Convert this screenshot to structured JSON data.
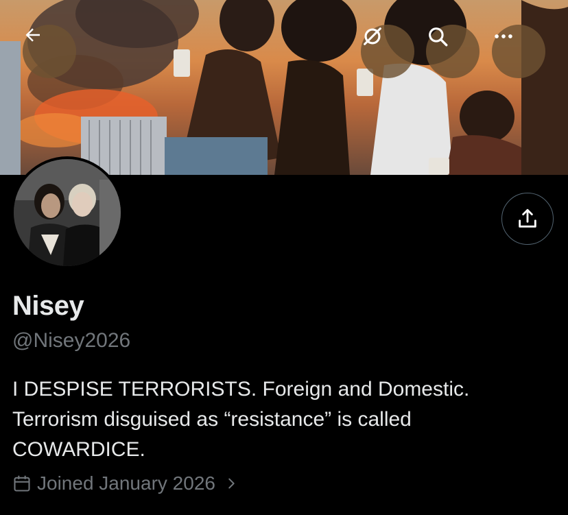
{
  "header": {
    "back_icon": "arrow-left-icon",
    "grok_icon": "grok-icon",
    "search_icon": "search-icon",
    "more_icon": "more-horizontal-icon"
  },
  "profile": {
    "display_name": "Nisey",
    "handle": "@Nisey2026",
    "bio_lines": [
      "I DESPISE TERRORISTS. Foreign and Domestic.",
      "Terrorism disguised as “resistance” is called",
      "COWARDICE."
    ],
    "joined": "Joined January 2026"
  },
  "colors": {
    "background": "#000000",
    "primary_text": "#e7e9ea",
    "secondary_text": "#71767b",
    "overlay_button": "#6e5232"
  }
}
